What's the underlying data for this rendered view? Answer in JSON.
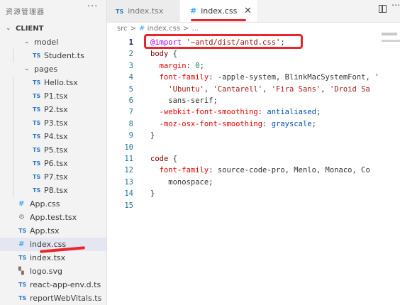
{
  "sidebar": {
    "title": "资源管理器",
    "more": "···",
    "root": "CLIENT",
    "items": [
      {
        "label": "model",
        "type": "folder"
      },
      {
        "label": "Student.ts",
        "type": "ts"
      },
      {
        "label": "pages",
        "type": "folder"
      },
      {
        "label": "Hello.tsx",
        "type": "ts"
      },
      {
        "label": "P1.tsx",
        "type": "ts"
      },
      {
        "label": "P2.tsx",
        "type": "ts"
      },
      {
        "label": "P3.tsx",
        "type": "ts"
      },
      {
        "label": "P4.tsx",
        "type": "ts"
      },
      {
        "label": "P5.tsx",
        "type": "ts"
      },
      {
        "label": "P6.tsx",
        "type": "ts"
      },
      {
        "label": "P7.tsx",
        "type": "ts"
      },
      {
        "label": "P8.tsx",
        "type": "ts"
      },
      {
        "label": "App.css",
        "type": "css"
      },
      {
        "label": "App.test.tsx",
        "type": "test"
      },
      {
        "label": "App.tsx",
        "type": "ts"
      },
      {
        "label": "index.css",
        "type": "css"
      },
      {
        "label": "index.tsx",
        "type": "ts"
      },
      {
        "label": "logo.svg",
        "type": "svg"
      },
      {
        "label": "react-app-env.d.ts",
        "type": "ts"
      },
      {
        "label": "reportWebVitals.ts",
        "type": "ts"
      }
    ],
    "selected": "index.css"
  },
  "icons": {
    "ts": "TS",
    "css": "#",
    "test": "⚙",
    "svg": "▚",
    "chevron_down": "⌄",
    "close": "✕"
  },
  "tabs": [
    {
      "label": "index.tsx",
      "icon": "TS",
      "active": false
    },
    {
      "label": "index.css",
      "icon": "#",
      "active": true
    }
  ],
  "breadcrumb": {
    "root": "src",
    "sep": ">",
    "icon": "#",
    "file": "index.css",
    "trail": "..."
  },
  "code_lines": [
    [
      {
        "t": "@import",
        "c": "kw"
      },
      {
        "t": " ",
        "c": "p"
      },
      {
        "t": "'~antd/dist/antd.css'",
        "c": "str"
      },
      {
        "t": ";",
        "c": "p"
      }
    ],
    [
      {
        "t": "body",
        "c": "sel"
      },
      {
        "t": " {",
        "c": "p"
      }
    ],
    [
      {
        "t": "  margin",
        "c": "prop"
      },
      {
        "t": ": ",
        "c": "p"
      },
      {
        "t": "0",
        "c": "num"
      },
      {
        "t": ";",
        "c": "p"
      }
    ],
    [
      {
        "t": "  font-family",
        "c": "prop"
      },
      {
        "t": ": -apple-system, BlinkMacSystemFont, '",
        "c": "p"
      }
    ],
    [
      {
        "t": "    ",
        "c": "p"
      },
      {
        "t": "'Ubuntu'",
        "c": "str"
      },
      {
        "t": ", ",
        "c": "p"
      },
      {
        "t": "'Cantarell'",
        "c": "str"
      },
      {
        "t": ", ",
        "c": "p"
      },
      {
        "t": "'Fira Sans'",
        "c": "str"
      },
      {
        "t": ", ",
        "c": "p"
      },
      {
        "t": "'Droid Sa",
        "c": "str"
      }
    ],
    [
      {
        "t": "    sans-serif;",
        "c": "p"
      }
    ],
    [
      {
        "t": "  -webkit-font-smoothing",
        "c": "prop"
      },
      {
        "t": ": ",
        "c": "p"
      },
      {
        "t": "antialiased",
        "c": "val"
      },
      {
        "t": ";",
        "c": "p"
      }
    ],
    [
      {
        "t": "  -moz-osx-font-smoothing",
        "c": "prop"
      },
      {
        "t": ": ",
        "c": "p"
      },
      {
        "t": "grayscale",
        "c": "val"
      },
      {
        "t": ";",
        "c": "p"
      }
    ],
    [
      {
        "t": "}",
        "c": "p"
      }
    ],
    [],
    [
      {
        "t": "code",
        "c": "sel"
      },
      {
        "t": " {",
        "c": "p"
      }
    ],
    [
      {
        "t": "  font-family",
        "c": "prop"
      },
      {
        "t": ": source-code-pro, Menlo, Monaco, Co",
        "c": "p"
      }
    ],
    [
      {
        "t": "    monospace;",
        "c": "p"
      }
    ],
    [
      {
        "t": "}",
        "c": "p"
      }
    ],
    []
  ],
  "line_numbers": [
    "1",
    "2",
    "3",
    "4",
    "5",
    "6",
    "7",
    "8",
    "9",
    "10",
    "11",
    "12",
    "13",
    "14",
    "15"
  ],
  "active_line": 1,
  "colors": {
    "accent_red": "#e8262b",
    "ts_blue": "#3178c6",
    "css_blue": "#42a5f5"
  }
}
